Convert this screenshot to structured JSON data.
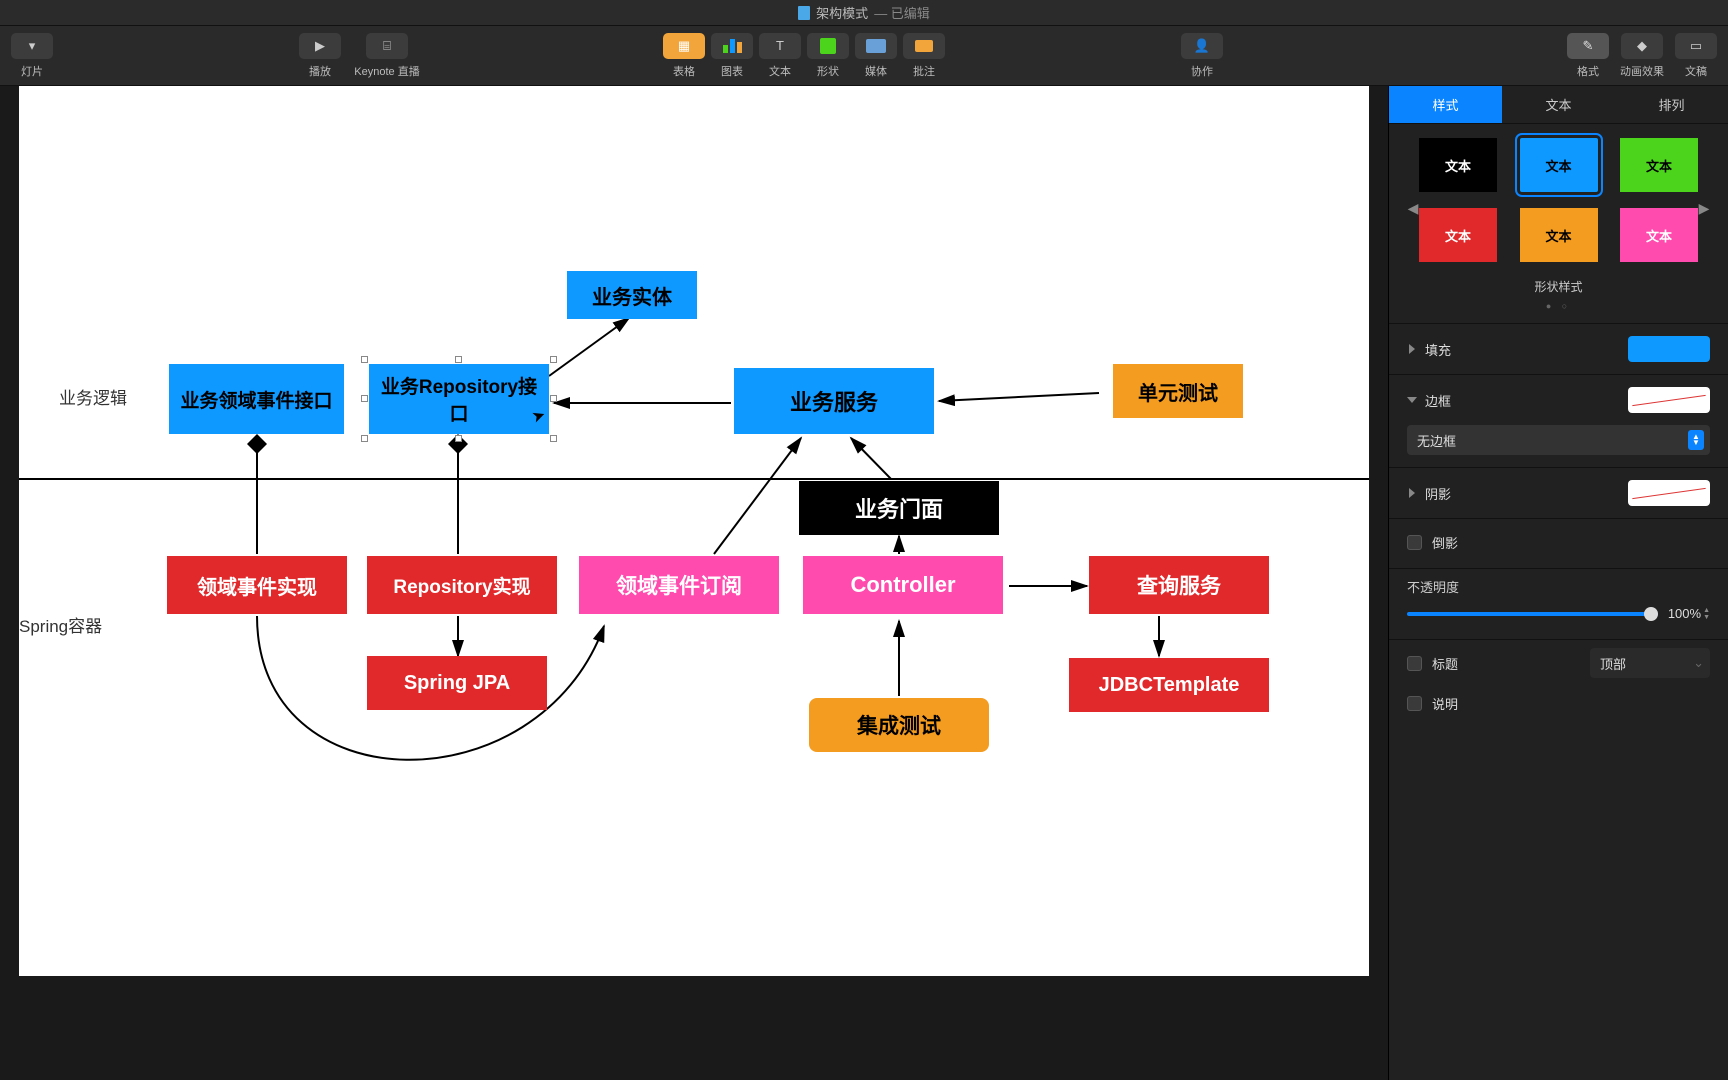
{
  "title": {
    "doc": "架构模式",
    "edited": "— 已编辑"
  },
  "toolbar": {
    "slides": "灯片",
    "play": "播放",
    "live": "Keynote 直播",
    "table": "表格",
    "chart": "图表",
    "text": "文本",
    "shape": "形状",
    "media": "媒体",
    "comment": "批注",
    "collab": "协作",
    "format": "格式",
    "animate": "动画效果",
    "document": "文稿"
  },
  "canvas": {
    "labels": {
      "business_logic": "业务逻辑",
      "spring_container": "Spring容器"
    },
    "nodes": {
      "biz_entity": "业务实体",
      "biz_domain_event_if": "业务领域事件接口",
      "biz_repo_if": "业务Repository接口",
      "biz_service": "业务服务",
      "unit_test": "单元测试",
      "biz_facade": "业务门面",
      "domain_event_impl": "领域事件实现",
      "repo_impl": "Repository实现",
      "domain_event_sub": "领域事件订阅",
      "controller": "Controller",
      "query_service": "查询服务",
      "spring_jpa": "Spring JPA",
      "integration_test": "集成测试",
      "jdbc_template": "JDBCTemplate"
    }
  },
  "inspector": {
    "tabs": {
      "style": "样式",
      "text": "文本",
      "arrange": "排列"
    },
    "swatch_label": "文本",
    "shape_style": "形状样式",
    "fill": "填充",
    "border": "边框",
    "border_value": "无边框",
    "shadow": "阴影",
    "reflection": "倒影",
    "opacity": "不透明度",
    "opacity_value": "100%",
    "title": "标题",
    "description": "说明",
    "title_pos": "顶部"
  }
}
